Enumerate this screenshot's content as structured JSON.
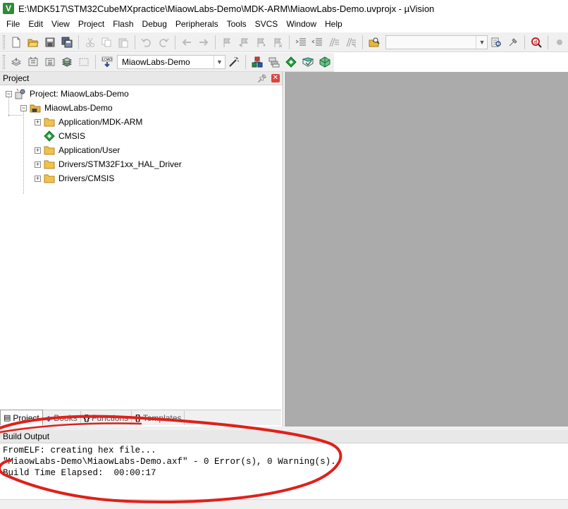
{
  "window": {
    "title": "E:\\MDK517\\STM32CubeMXpractice\\MiaowLabs-Demo\\MDK-ARM\\MiaowLabs-Demo.uvprojx - µVision",
    "logo_text": "V"
  },
  "menu": [
    {
      "label": "File"
    },
    {
      "label": "Edit"
    },
    {
      "label": "View"
    },
    {
      "label": "Project"
    },
    {
      "label": "Flash"
    },
    {
      "label": "Debug"
    },
    {
      "label": "Peripherals"
    },
    {
      "label": "Tools"
    },
    {
      "label": "SVCS"
    },
    {
      "label": "Window"
    },
    {
      "label": "Help"
    }
  ],
  "toolbar2": {
    "load_label": "LOAD",
    "target_value": "MiaowLabs-Demo"
  },
  "project_panel": {
    "title": "Project",
    "pin_icon": "pin-icon",
    "close_icon": "close-icon",
    "tree": {
      "root": "Project: MiaowLabs-Demo",
      "target": "MiaowLabs-Demo",
      "groups": [
        {
          "label": "Application/MDK-ARM",
          "icon": "folder-icon",
          "expandable": true
        },
        {
          "label": "CMSIS",
          "icon": "cmsis-diamond-icon",
          "expandable": false
        },
        {
          "label": "Application/User",
          "icon": "folder-icon",
          "expandable": true
        },
        {
          "label": "Drivers/STM32F1xx_HAL_Driver",
          "icon": "folder-icon",
          "expandable": true
        },
        {
          "label": "Drivers/CMSIS",
          "icon": "folder-icon",
          "expandable": true
        }
      ]
    },
    "tabs": [
      {
        "label": "Project",
        "icon": "project-icon",
        "active": true
      },
      {
        "label": "Books",
        "icon": "books-icon",
        "active": false
      },
      {
        "label": "Functions",
        "icon": "functions-icon",
        "active": false
      },
      {
        "label": "Templates",
        "icon": "templates-icon",
        "active": false
      }
    ]
  },
  "build_output": {
    "title": "Build Output",
    "lines": [
      "FromELF: creating hex file...",
      "\"MiaowLabs-Demo\\MiaowLabs-Demo.axf\" - 0 Error(s), 0 Warning(s).",
      "Build Time Elapsed:  00:00:17"
    ]
  },
  "colors": {
    "editor_bg": "#ababab",
    "annotation": "#e0201a",
    "folder": "#e8b63c",
    "cmsis": "#22a43a"
  }
}
